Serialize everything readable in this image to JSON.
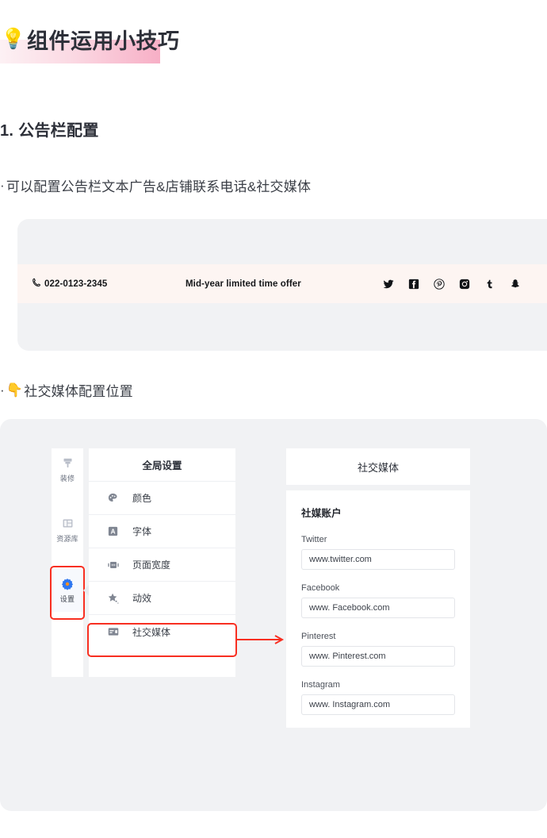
{
  "page": {
    "title": "组件运用小技巧",
    "title_icon": "lightbulb-icon",
    "section_number_heading": "1. 公告栏配置",
    "bullet_dot": "·",
    "bullet_1": "可以配置公告栏文本广告&店铺联系电话&社交媒体",
    "bullet_2": "社交媒体配置位置",
    "pointer_icon": "pointing-down-emoji"
  },
  "announcement_bar": {
    "phone_icon": "phone-icon",
    "phone": "022-0123-2345",
    "message": "Mid-year limited time offer",
    "socials": [
      {
        "name": "twitter-icon",
        "label": "Twitter"
      },
      {
        "name": "facebook-icon",
        "label": "Facebook"
      },
      {
        "name": "pinterest-icon",
        "label": "Pinterest"
      },
      {
        "name": "instagram-icon",
        "label": "Instagram"
      },
      {
        "name": "tumblr-icon",
        "label": "Tumblr"
      },
      {
        "name": "snapchat-icon",
        "label": "Snapchat"
      }
    ]
  },
  "admin": {
    "rail": [
      {
        "icon": "brush-icon",
        "label": "装修",
        "selected": false
      },
      {
        "icon": "library-icon",
        "label": "资源库",
        "selected": false
      },
      {
        "icon": "gear-icon",
        "label": "设置",
        "selected": true
      }
    ],
    "menu": {
      "title": "全局设置",
      "items": [
        {
          "icon": "palette-icon",
          "label": "颜色",
          "highlighted": false
        },
        {
          "icon": "font-icon",
          "label": "字体",
          "highlighted": false
        },
        {
          "icon": "page-width-icon",
          "label": "页面宽度",
          "highlighted": false
        },
        {
          "icon": "sparkle-star-icon",
          "label": "动效",
          "highlighted": false
        },
        {
          "icon": "social-card-icon",
          "label": "社交媒体",
          "highlighted": true
        }
      ]
    },
    "detail": {
      "header": "社交媒体",
      "group_title": "社媒账户",
      "fields": [
        {
          "label": "Twitter",
          "value": "www.twitter.com"
        },
        {
          "label": "Facebook",
          "value": "www. Facebook.com"
        },
        {
          "label": "Pinterest",
          "value": "www. Pinterest.com"
        },
        {
          "label": "Instagram",
          "value": "www. Instagram.com"
        }
      ]
    }
  },
  "colors": {
    "highlight_red": "#f82f21",
    "accent_blue": "#2f77f0",
    "card_bg": "#f1f2f4",
    "announce_bg": "#fdf5f2"
  }
}
